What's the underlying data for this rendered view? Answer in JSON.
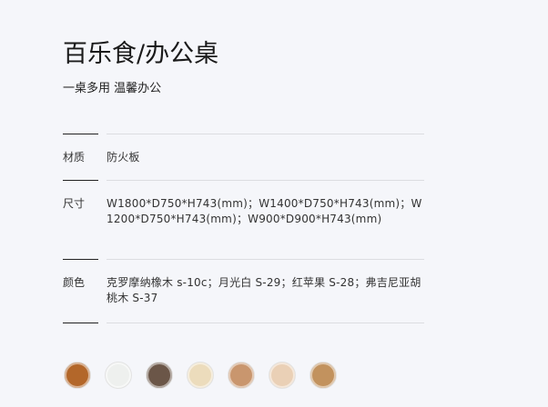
{
  "product": {
    "title": "百乐食/办公桌",
    "subtitle": "一桌多用 温馨办公"
  },
  "specs": [
    {
      "label": "材质",
      "value": "防火板"
    },
    {
      "label": "尺寸",
      "value": "W1800*D750*H743(mm)；W1400*D750*H743(mm)；W1200*D750*H743(mm)；W900*D900*H743(mm)"
    },
    {
      "label": "颜色",
      "value": "克罗摩纳橡木 s-10c；月光白 S-29；红苹果 S-28；弗吉尼亚胡桃木 S-37"
    }
  ],
  "swatches": [
    {
      "name": "swatch-1",
      "color": "#b3672a"
    },
    {
      "name": "swatch-2",
      "color": "#eef0ee"
    },
    {
      "name": "swatch-3",
      "color": "#6b5648"
    },
    {
      "name": "swatch-4",
      "color": "#ecdcbc"
    },
    {
      "name": "swatch-5",
      "color": "#c9966e"
    },
    {
      "name": "swatch-6",
      "color": "#ead0b6"
    },
    {
      "name": "swatch-7",
      "color": "#c2925e"
    }
  ]
}
